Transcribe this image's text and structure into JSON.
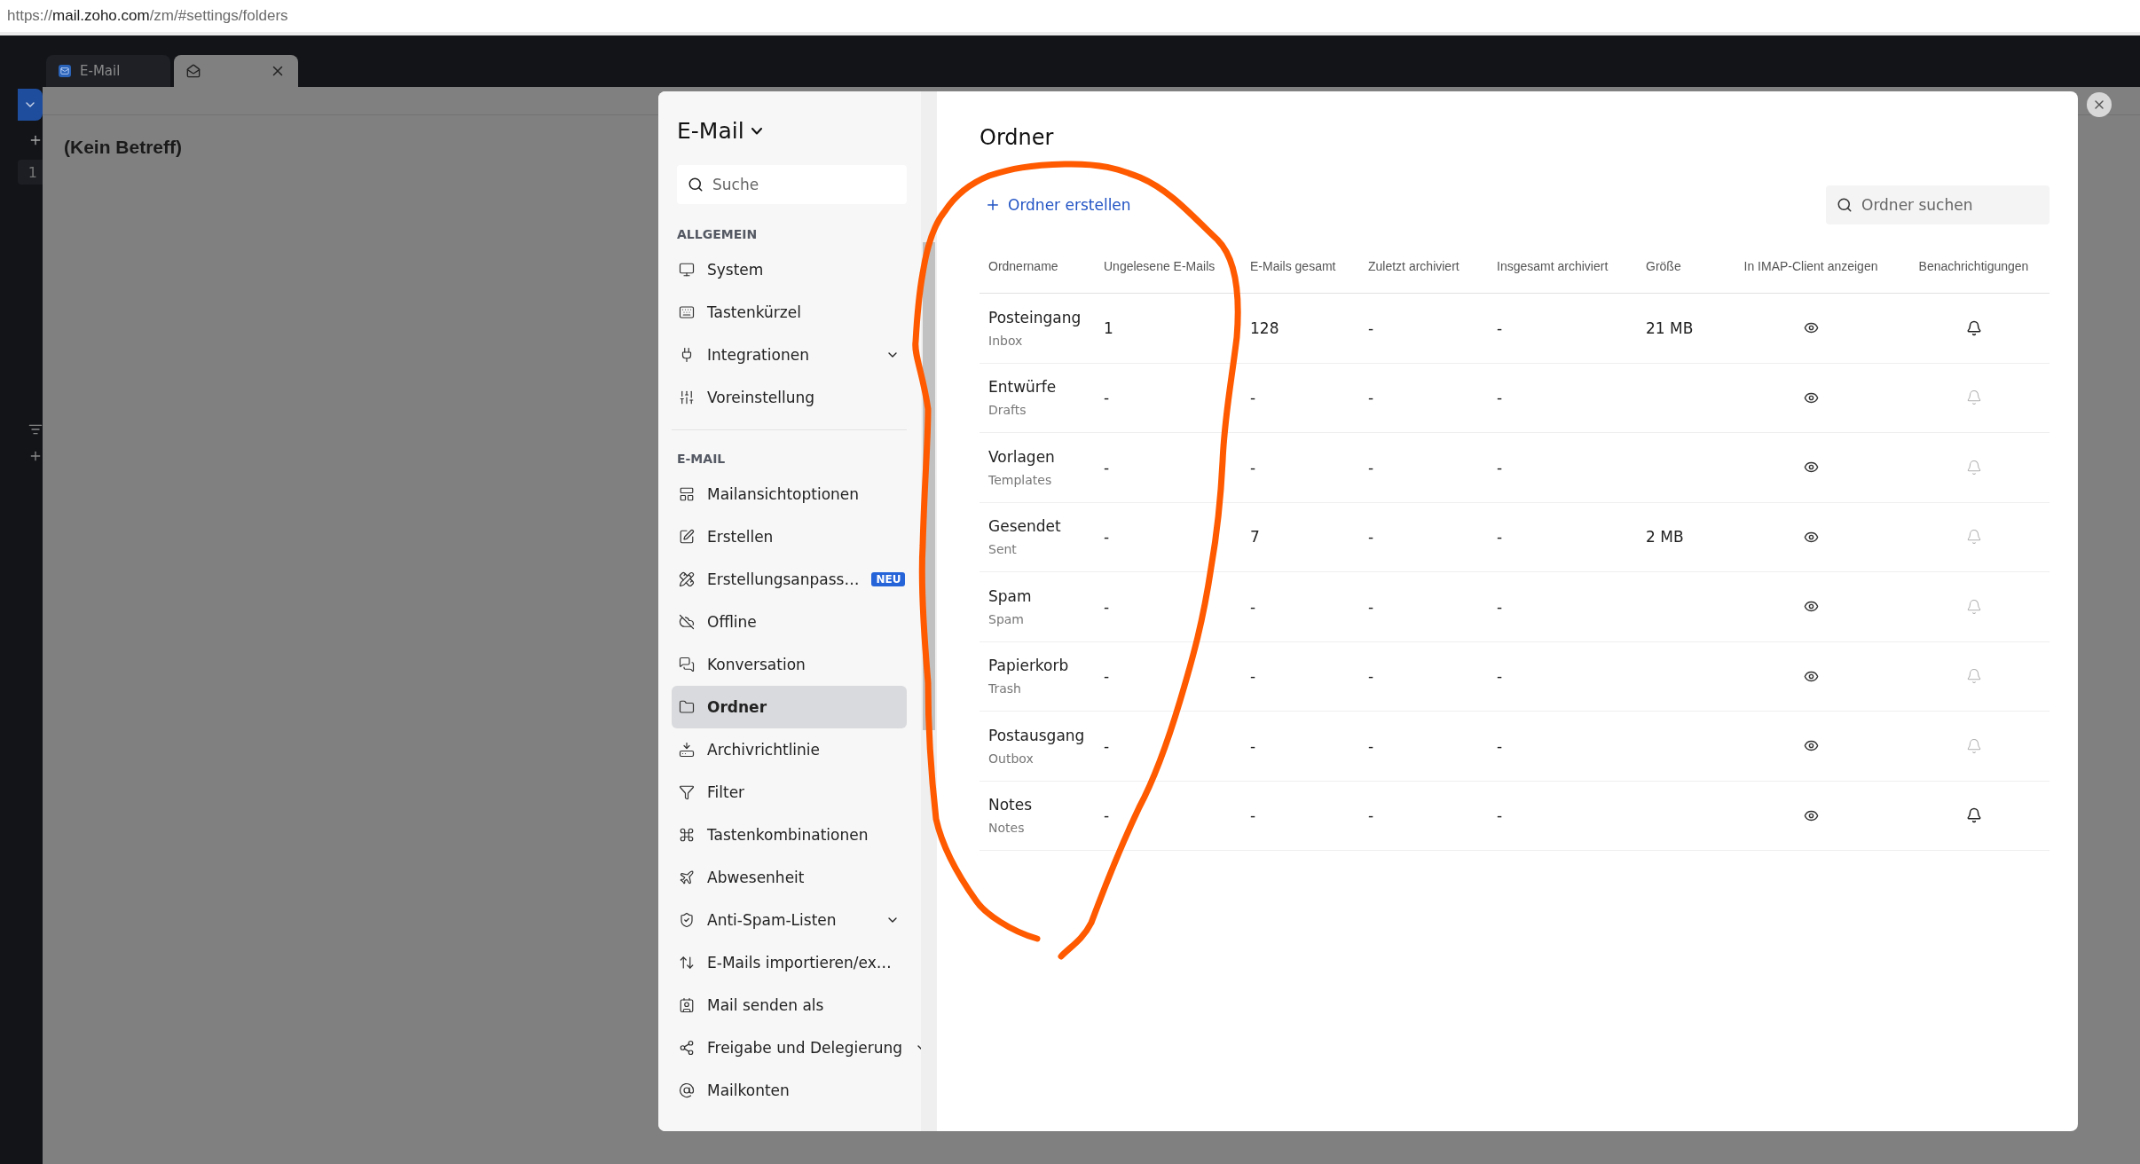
{
  "browser": {
    "url_scheme": "https://",
    "url_host": "mail.zoho.com",
    "url_path": "/zm/#settings/folders"
  },
  "tabs": [
    {
      "label": "E-Mail",
      "selected": false,
      "closable": false
    },
    {
      "selected": true,
      "closable": true
    }
  ],
  "rail": {
    "count": "1"
  },
  "mail": {
    "subject": "(Kein Betreff)"
  },
  "settings": {
    "app_title": "E-Mail",
    "search_placeholder": "Suche",
    "sections": [
      {
        "title": "ALLGEMEIN",
        "items": [
          {
            "label": "System",
            "selected": false,
            "expandable": false
          },
          {
            "label": "Tastenkürzel",
            "selected": false,
            "expandable": false
          },
          {
            "label": "Integrationen",
            "selected": false,
            "expandable": true
          },
          {
            "label": "Voreinstellung",
            "selected": false,
            "expandable": false
          }
        ]
      },
      {
        "title": "E-MAIL",
        "items": [
          {
            "label": "Mailansichtoptionen",
            "selected": false,
            "expandable": false
          },
          {
            "label": "Erstellen",
            "selected": false,
            "expandable": false
          },
          {
            "label": "Erstellungsanpass…",
            "selected": false,
            "expandable": false,
            "badge": "NEU"
          },
          {
            "label": "Offline",
            "selected": false,
            "expandable": false
          },
          {
            "label": "Konversation",
            "selected": false,
            "expandable": false
          },
          {
            "label": "Ordner",
            "selected": true,
            "expandable": false
          },
          {
            "label": "Archivrichtlinie",
            "selected": false,
            "expandable": false
          },
          {
            "label": "Filter",
            "selected": false,
            "expandable": false
          },
          {
            "label": "Tastenkombinationen",
            "selected": false,
            "expandable": false
          },
          {
            "label": "Abwesenheit",
            "selected": false,
            "expandable": false
          },
          {
            "label": "Anti-Spam-Listen",
            "selected": false,
            "expandable": true
          },
          {
            "label": "E-Mails importieren/ex…",
            "selected": false,
            "expandable": false
          },
          {
            "label": "Mail senden als",
            "selected": false,
            "expandable": false
          },
          {
            "label": "Freigabe und Delegierung",
            "selected": false,
            "expandable": true
          },
          {
            "label": "Mailkonten",
            "selected": false,
            "expandable": false
          }
        ]
      }
    ]
  },
  "page": {
    "title": "Ordner",
    "create_label": "Ordner erstellen",
    "search_placeholder": "Ordner suchen",
    "columns": [
      "Ordnername",
      "Ungelesene E-Mails",
      "E-Mails gesamt",
      "Zuletzt archiviert",
      "Insgesamt archiviert",
      "Größe",
      "In IMAP-Client anzeigen",
      "Benachrichtigungen"
    ],
    "rows": [
      {
        "name": "Posteingang",
        "subtitle": "Inbox",
        "unread": "1",
        "total": "128",
        "last_archived": "-",
        "total_archived": "-",
        "size": "21 MB",
        "imap_visible": true,
        "notifications": true
      },
      {
        "name": "Entwürfe",
        "subtitle": "Drafts",
        "unread": "-",
        "total": "-",
        "last_archived": "-",
        "total_archived": "-",
        "imap_visible": true,
        "notifications": false
      },
      {
        "name": "Vorlagen",
        "subtitle": "Templates",
        "unread": "-",
        "total": "-",
        "last_archived": "-",
        "total_archived": "-",
        "imap_visible": true,
        "notifications": false
      },
      {
        "name": "Gesendet",
        "subtitle": "Sent",
        "unread": "-",
        "total": "7",
        "last_archived": "-",
        "total_archived": "-",
        "size": "2 MB",
        "imap_visible": true,
        "notifications": false
      },
      {
        "name": "Spam",
        "subtitle": "Spam",
        "unread": "-",
        "total": "-",
        "last_archived": "-",
        "total_archived": "-",
        "imap_visible": true,
        "notifications": false
      },
      {
        "name": "Papierkorb",
        "subtitle": "Trash",
        "unread": "-",
        "total": "-",
        "last_archived": "-",
        "total_archived": "-",
        "imap_visible": true,
        "notifications": false
      },
      {
        "name": "Postausgang",
        "subtitle": "Outbox",
        "unread": "-",
        "total": "-",
        "last_archived": "-",
        "total_archived": "-",
        "imap_visible": true,
        "notifications": false
      },
      {
        "name": "Notes",
        "subtitle": "Notes",
        "unread": "-",
        "total": "-",
        "last_archived": "-",
        "total_archived": "-",
        "imap_visible": true,
        "notifications": true
      }
    ]
  }
}
